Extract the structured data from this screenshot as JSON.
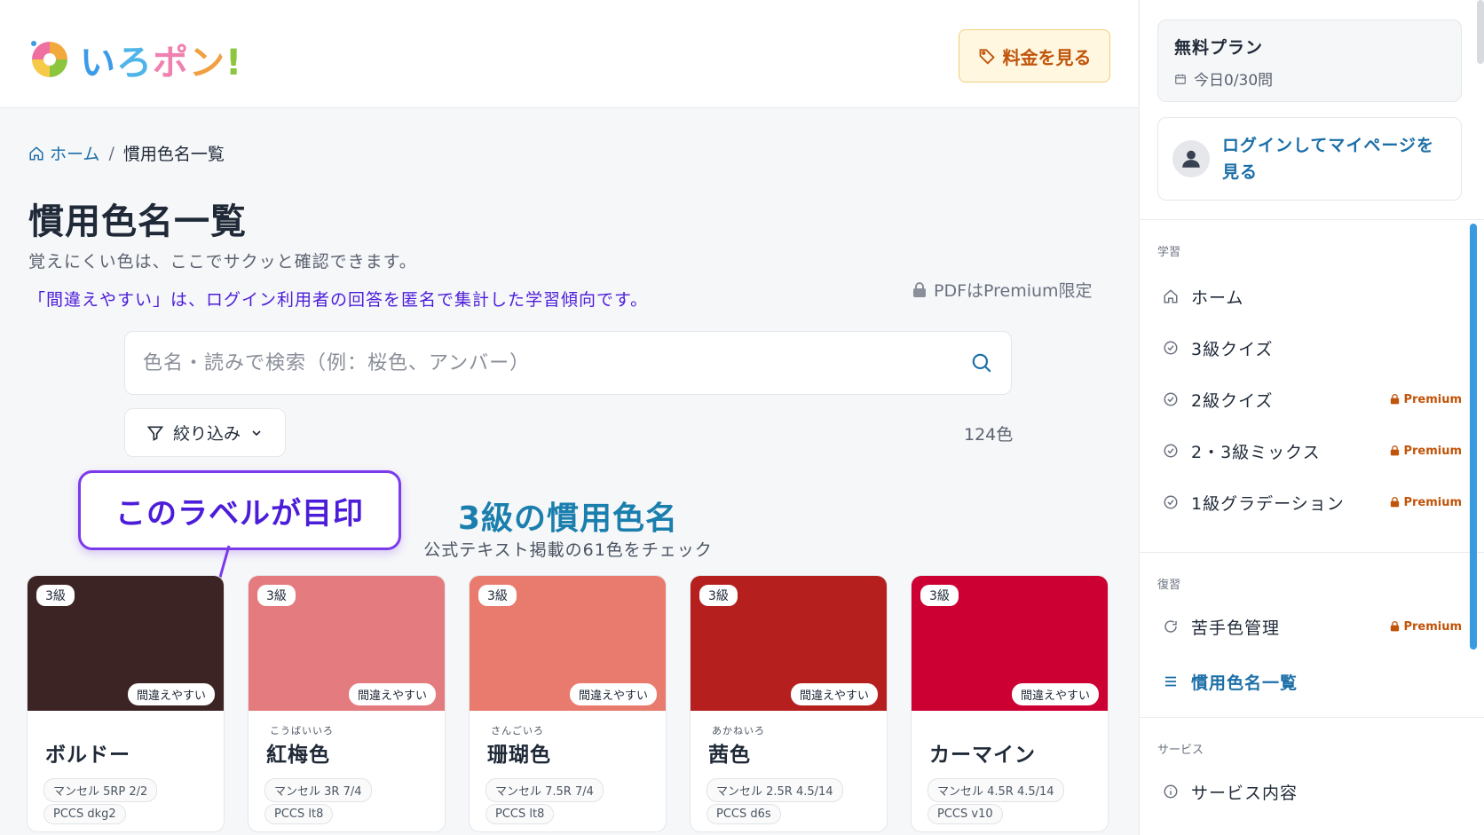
{
  "header": {
    "logo_text": [
      "い",
      "ろ",
      "ポ",
      "ン",
      "!"
    ],
    "price_button": "料金を見る",
    "tag_icon": "tag-icon"
  },
  "breadcrumb": {
    "home": "ホーム",
    "separator": "/",
    "current": "慣用色名一覧"
  },
  "page": {
    "title": "慣用色名一覧",
    "description": "覚えにくい色は、ここでサクッと確認できます。",
    "notice": "「間違えやすい」は、ログイン利用者の回答を匿名で集計した学習傾向です。",
    "pdf_notice": "PDFはPremium限定"
  },
  "search": {
    "placeholder": "色名・読みで検索（例：桜色、アンバー）",
    "value": ""
  },
  "filter": {
    "label": "絞り込み",
    "count": "124色"
  },
  "callout": {
    "text": "このラベルが目印"
  },
  "section": {
    "title": "3級の慣用色名",
    "subtitle": "公式テキスト掲載の61色をチェック"
  },
  "cards": [
    {
      "grade": "3級",
      "mistake": "間違えやすい",
      "ruby": "",
      "name": "ボルドー",
      "munsell": "マンセル 5RP 2/2",
      "pccs": "PCCS dkg2",
      "color": "#3d2424"
    },
    {
      "grade": "3級",
      "mistake": "間違えやすい",
      "ruby": "こうばいいろ",
      "name": "紅梅色",
      "munsell": "マンセル 3R 7/4",
      "pccs": "PCCS lt8",
      "color": "#e47b7e"
    },
    {
      "grade": "3級",
      "mistake": "間違えやすい",
      "ruby": "さんごいろ",
      "name": "珊瑚色",
      "munsell": "マンセル 7.5R 7/4",
      "pccs": "PCCS lt8",
      "color": "#e87b6d"
    },
    {
      "grade": "3級",
      "mistake": "間違えやすい",
      "ruby": "あかねいろ",
      "name": "茜色",
      "munsell": "マンセル 2.5R 4.5/14",
      "pccs": "PCCS d6s",
      "color": "#b5201f"
    },
    {
      "grade": "3級",
      "mistake": "間違えやすい",
      "ruby": "",
      "name": "カーマイン",
      "munsell": "マンセル 4.5R 4.5/14",
      "pccs": "PCCS v10",
      "color": "#cc0032"
    }
  ],
  "sidebar": {
    "plan_name": "無料プラン",
    "plan_quota": "今日0/30問",
    "login_text_line1": "ログインしてマイページを",
    "login_text_line2": "見る",
    "premium_label": "Premium",
    "sections": {
      "study": "学習",
      "review": "復習",
      "service": "サービス"
    },
    "study_items": [
      {
        "label": "ホーム",
        "icon": "home-icon",
        "premium": false
      },
      {
        "label": "3級クイズ",
        "icon": "check-circle-icon",
        "premium": false
      },
      {
        "label": "2級クイズ",
        "icon": "check-circle-icon",
        "premium": true
      },
      {
        "label": "2・3級ミックス",
        "icon": "check-circle-icon",
        "premium": true
      },
      {
        "label": "1級グラデーション",
        "icon": "check-circle-icon",
        "premium": true
      }
    ],
    "review_items": [
      {
        "label": "苦手色管理",
        "icon": "refresh-icon",
        "premium": true
      },
      {
        "label": "慣用色名一覧",
        "icon": "list-icon",
        "premium": false,
        "active": true
      }
    ],
    "service_items": [
      {
        "label": "サービス内容",
        "icon": "info-icon",
        "premium": false
      }
    ]
  },
  "colors": {
    "accent": "#1b6ea8",
    "premium": "#c0540a",
    "callout": "#7c3aed",
    "section_title": "#1b7fae"
  }
}
